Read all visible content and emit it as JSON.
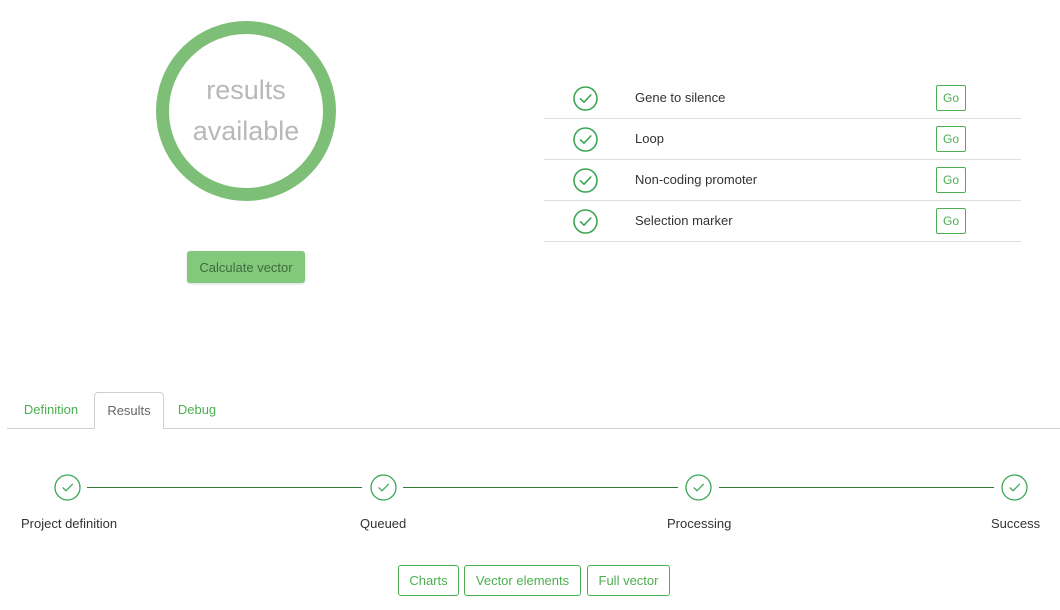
{
  "status": {
    "line1": "results",
    "line2": "available",
    "ring_color": "#7dbf77"
  },
  "calculate_button": "Calculate vector",
  "checklist": [
    {
      "label": "Gene to silence",
      "status_icon": "check-circle-icon",
      "action": "Go"
    },
    {
      "label": "Loop",
      "status_icon": "check-circle-icon",
      "action": "Go"
    },
    {
      "label": "Non-coding promoter",
      "status_icon": "check-circle-icon",
      "action": "Go"
    },
    {
      "label": "Selection marker",
      "status_icon": "check-circle-icon",
      "action": "Go"
    }
  ],
  "tabs": [
    {
      "label": "Definition",
      "active": false
    },
    {
      "label": "Results",
      "active": true
    },
    {
      "label": "Debug",
      "active": false
    }
  ],
  "steps": [
    {
      "label": "Project definition",
      "done": true
    },
    {
      "label": "Queued",
      "done": true
    },
    {
      "label": "Processing",
      "done": true
    },
    {
      "label": "Success",
      "done": true
    }
  ],
  "bottom_buttons": [
    "Charts",
    "Vector elements",
    "Full vector"
  ],
  "colors": {
    "accent": "#4caf50",
    "button_fill": "#82c97c",
    "step_line": "#2e7d32"
  }
}
